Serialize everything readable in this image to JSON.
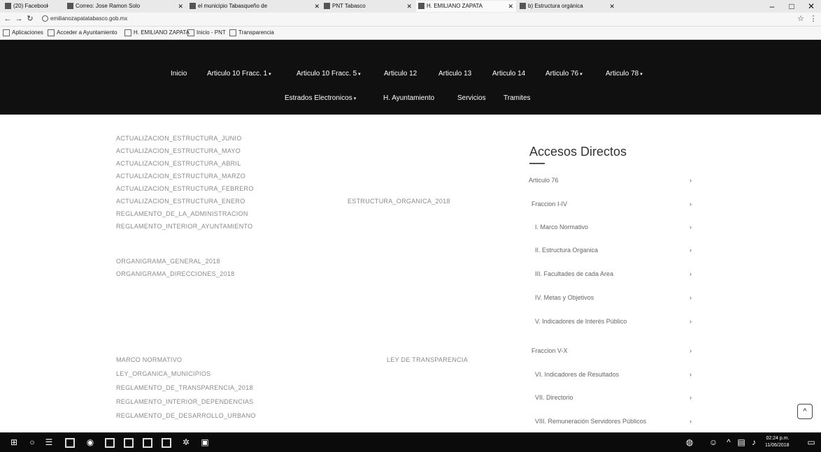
{
  "browser": {
    "tabs": [
      {
        "label": "(20) Facebook",
        "active": false
      },
      {
        "label": "Correo: Jose Ramon Solo",
        "active": false
      },
      {
        "label": "el municipio Tabasqueño de",
        "active": false
      },
      {
        "label": "PNT Tabasco",
        "active": false
      },
      {
        "label": "H. EMILIANO ZAPATA",
        "active": true
      },
      {
        "label": "b) Estructura orgánica",
        "active": false
      }
    ],
    "window_buttons": [
      "–",
      "□",
      "✕"
    ],
    "url": "emilianozapatatabasco.gob.mx",
    "bookmarks": [
      "Aplicaciones",
      "Acceder a Ayuntamiento",
      "H. EMILIANO ZAPATA",
      "Inicio - PNT",
      "Transparencia"
    ]
  },
  "nav": {
    "row1": [
      {
        "label": "Inicio",
        "caret": ""
      },
      {
        "label": "Articulo 10 Fracc. 1",
        "caret": "▾"
      },
      {
        "label": "Articulo 10 Fracc. 5",
        "caret": "▾"
      },
      {
        "label": "Articulo 12",
        "caret": ""
      },
      {
        "label": "Articulo 13",
        "caret": ""
      },
      {
        "label": "Articulo 14",
        "caret": ""
      },
      {
        "label": "Articulo 76",
        "caret": "▾"
      },
      {
        "label": "Articulo 78",
        "caret": "▾"
      }
    ],
    "row2": [
      {
        "label": "Estrados Electronicos",
        "caret": "▾"
      },
      {
        "label": "H. Ayuntamiento",
        "caret": ""
      },
      {
        "label": "Servicios",
        "caret": ""
      },
      {
        "label": "Tramites",
        "caret": ""
      }
    ]
  },
  "content": {
    "list1": [
      "ACTUALIZACION_ESTRUCTURA_JUNIO",
      "ACTUALIZACION_ESTRUCTURA_MAYO",
      "ACTUALIZACION_ESTRUCTURA_ABRIL",
      "ACTUALIZACION_ESTRUCTURA_MARZO",
      "ACTUALIZACION_ESTRUCTURA_FEBRERO",
      "ACTUALIZACION_ESTRUCTURA_ENERO",
      "REGLAMENTO_DE_LA_ADMINISTRACION",
      "REGLAMENTO_INTERIOR_AYUNTAMIENTO"
    ],
    "aside_text": "ESTRUCTURA_ORGANICA_2018",
    "list2": [
      "ORGANIGRAMA_GENERAL_2018",
      "ORGANIGRAMA_DIRECCIONES_2018"
    ],
    "marco_label": "MARCO NORMATIVO",
    "marco_aside": "LEY DE TRANSPARENCIA",
    "list3": [
      "LEY_ORGANICA_MUNICIPIOS",
      "REGLAMENTO_DE_TRANSPARENCIA_2018",
      "REGLAMENTO_INTERIOR_DEPENDENCIAS",
      "REGLAMENTO_DE_DESARROLLO_URBANO"
    ]
  },
  "sidebar": {
    "title": "Accesos Directos",
    "items": [
      {
        "label": "Articulo 76",
        "indent": 0
      },
      {
        "label": "Fraccion I-IV",
        "indent": 1
      },
      {
        "label": "I. Marco Normativo",
        "indent": 2
      },
      {
        "label": "II. Estructura Organica",
        "indent": 2
      },
      {
        "label": "III. Facultades de cada Area",
        "indent": 2
      },
      {
        "label": "IV. Metas y Objetivos",
        "indent": 2
      },
      {
        "label": "V. Indicadores de Interés Público",
        "indent": 2
      },
      {
        "label": "Fraccion V-X",
        "indent": 1
      },
      {
        "label": "VI. Indicadores de Resultados",
        "indent": 2
      },
      {
        "label": "VII. Directorio",
        "indent": 2
      },
      {
        "label": "VIII. Remuneración Servidores Públicos",
        "indent": 2
      }
    ],
    "arrow": "›"
  },
  "scroll_top_icon": "^",
  "taskbar": {
    "time": "02:24 p.m.",
    "date": "11/06/2018"
  }
}
